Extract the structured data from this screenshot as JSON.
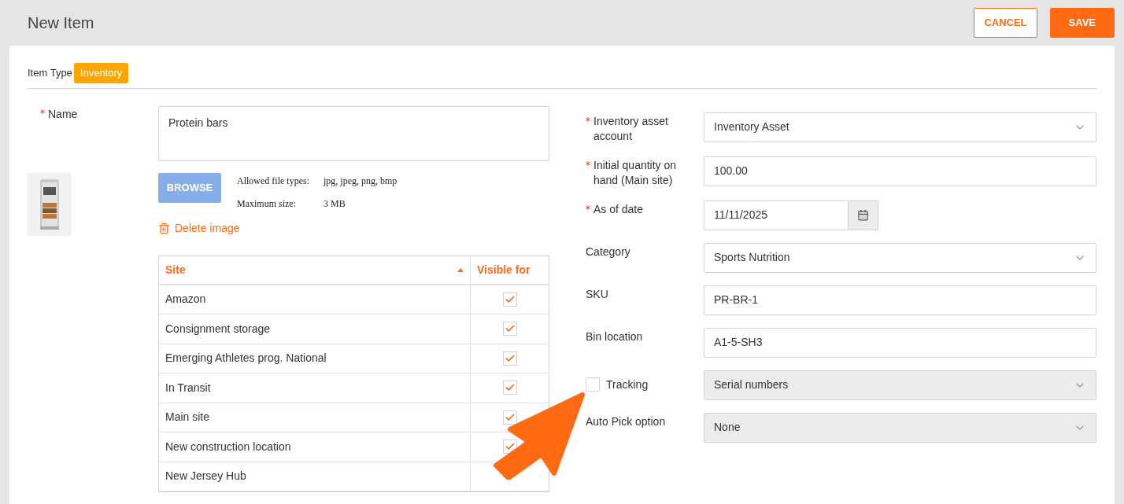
{
  "page_title": "New Item",
  "actions": [
    {
      "label": "CANCEL",
      "kind": "outline"
    },
    {
      "label": "SAVE",
      "kind": "primary"
    }
  ],
  "item_type": {
    "label": "Item Type",
    "value": "Inventory"
  },
  "name_field": {
    "label": "Name",
    "required": true,
    "value": "Protein bars"
  },
  "image": {
    "kind": "picture",
    "browse": "BROWSE",
    "delete": "Delete image",
    "info": [
      {
        "label": "Allowed file types:",
        "value": "jpg, jpeg, png, bmp"
      },
      {
        "label": "Maximum size:",
        "value": "3 MB"
      }
    ]
  },
  "sites_table": {
    "columns": [
      "Site",
      "Visible for"
    ],
    "rows": [
      {
        "site": "Amazon",
        "checked": true
      },
      {
        "site": "Consignment storage",
        "checked": true
      },
      {
        "site": "Emerging Athletes prog. National",
        "checked": true
      },
      {
        "site": "In Transit",
        "checked": true
      },
      {
        "site": "Main site",
        "checked": true
      },
      {
        "site": "New construction location",
        "checked": true
      },
      {
        "site": "New Jersey Hub"
      }
    ]
  },
  "fields": [
    {
      "kind": "select",
      "label": "Inventory asset account",
      "required": true,
      "value": "Inventory Asset",
      "disabled": false
    },
    {
      "kind": "text",
      "label": "Initial quantity on hand (Main site)",
      "required": true,
      "value": "100.00",
      "disabled": false
    },
    {
      "kind": "date",
      "label": "As of date",
      "required": true,
      "value": "11/11/2025",
      "disabled": false
    },
    {
      "kind": "select",
      "label": "Category",
      "required": false,
      "value": "Sports Nutrition",
      "disabled": false
    },
    {
      "kind": "text",
      "label": "SKU",
      "required": false,
      "value": "PR-BR-1",
      "disabled": false
    },
    {
      "kind": "text",
      "label": "Bin location",
      "required": false,
      "value": "A1-5-SH3",
      "disabled": false
    },
    {
      "kind": "checkselect",
      "label": "Tracking",
      "required": false,
      "checked": false,
      "value": "Serial numbers",
      "disabled": true
    },
    {
      "kind": "select",
      "label": "Auto Pick option",
      "required": false,
      "value": "None",
      "disabled": true
    }
  ]
}
